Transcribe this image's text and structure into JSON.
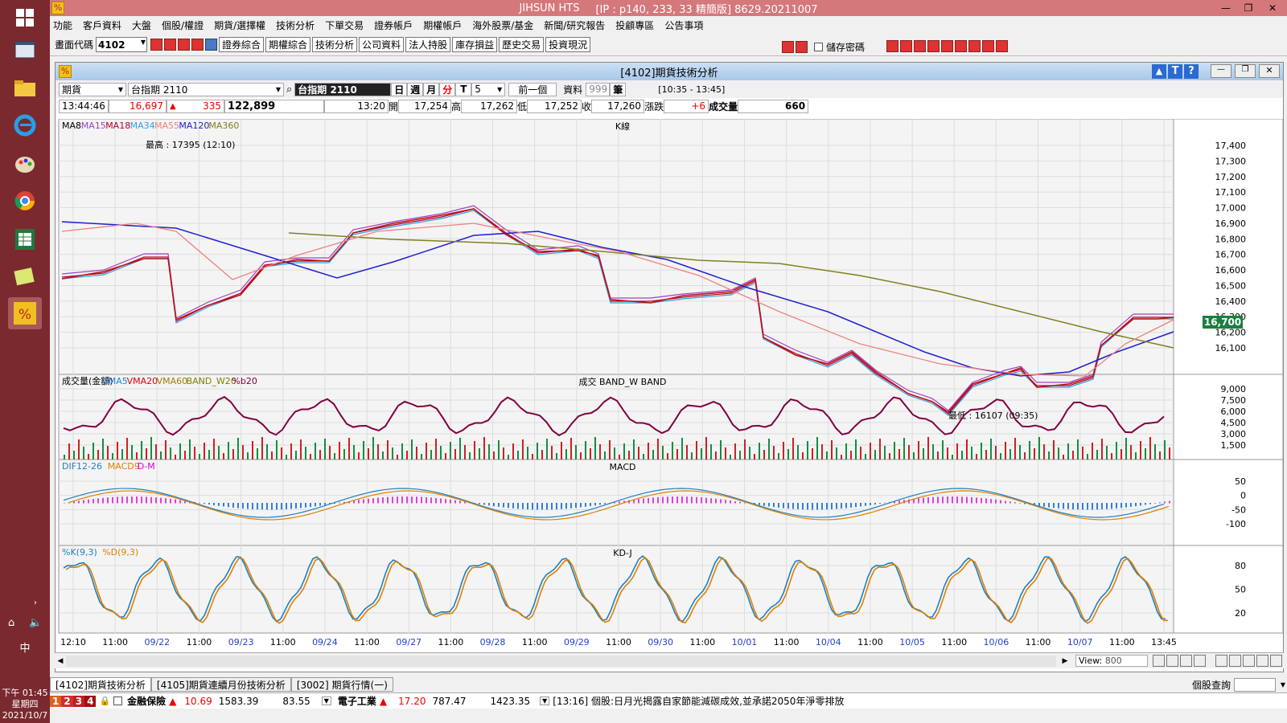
{
  "taskbar": {
    "clock_time": "下午 01:45",
    "clock_day": "星期四",
    "clock_date": "2021/10/7",
    "ime": "中"
  },
  "window": {
    "title": "JIHSUN HTS",
    "title_info": "[IP : p140, 233, 33 精簡版] 8629.20211007"
  },
  "menu": [
    "功能",
    "客戶資料",
    "大盤",
    "個股/權證",
    "期貨/選擇權",
    "技術分析",
    "下單交易",
    "證券帳戶",
    "期權帳戶",
    "海外股票/基金",
    "新聞/研究報告",
    "投顧專區",
    "公告事項"
  ],
  "toolbar": {
    "code_label": "畫面代碼",
    "code_value": "4102",
    "buttons": [
      "證券綜合",
      "期權綜合",
      "技術分析",
      "公司資料",
      "法人持股",
      "庫存損益",
      "歷史交易",
      "投資現況"
    ],
    "save_pwd": "儲存密碼"
  },
  "subwindow": {
    "title": "[4102]期貨技術分析"
  },
  "controls": {
    "type": "期貨",
    "contract": "台指期 2110",
    "name": "台指期 2110",
    "periods": [
      "日",
      "週",
      "月",
      "分",
      "T"
    ],
    "interval": "5",
    "prev": "前一個",
    "data_label": "資料",
    "data_count": "999",
    "unit": "筆",
    "time_range": "[10:35 - 13:45]"
  },
  "quote": {
    "time": "13:44:46",
    "price": "16,697",
    "change": "335",
    "volume_total": "122,899",
    "bar_time": "13:20",
    "open_label": "開",
    "open": "17,254",
    "high_label": "高",
    "high": "17,262",
    "low_label": "低",
    "low": "17,252",
    "close_label": "收",
    "close": "17,260",
    "chg_label": "漲跌",
    "chg": "+6",
    "vol_label": "成交量",
    "vol": "660"
  },
  "panels": {
    "k": {
      "title": "K線",
      "ma_labels": [
        {
          "t": "MA8",
          "c": "#000"
        },
        {
          "t": "MA15",
          "c": "#a040c0"
        },
        {
          "t": "MA18",
          "c": "#b00030"
        },
        {
          "t": "MA34",
          "c": "#30a0e0"
        },
        {
          "t": "MA55",
          "c": "#f08080"
        },
        {
          "t": "MA120",
          "c": "#2020d0"
        },
        {
          "t": "MA360",
          "c": "#808020"
        }
      ],
      "high_note": "最高 : 17395 (12:10)",
      "low_note": "最低 : 16107 (09:35)",
      "yticks": [
        "17,400",
        "17,300",
        "17,200",
        "17,100",
        "17,000",
        "16,900",
        "16,800",
        "16,700",
        "16,600",
        "16,500",
        "16,400",
        "16,300",
        "16,200",
        "16,100"
      ],
      "last": "16,700"
    },
    "vol": {
      "title": "成交  BAND_W  BAND",
      "labels": [
        {
          "t": "成交量(金額)",
          "c": "#000"
        },
        {
          "t": "VMA5",
          "c": "#2080e0"
        },
        {
          "t": "VMA20",
          "c": "#e00000"
        },
        {
          "t": "VMA60",
          "c": "#a08000"
        },
        {
          "t": "BAND_W20",
          "c": "#808000"
        },
        {
          "t": "%b20",
          "c": "#800040"
        }
      ],
      "yticks": [
        "9,000",
        "7,500",
        "6,000",
        "4,500",
        "3,000",
        "1,500"
      ]
    },
    "macd": {
      "title": "MACD",
      "labels": [
        {
          "t": "DIF12-26",
          "c": "#2080c0"
        },
        {
          "t": "MACD9",
          "c": "#e08000"
        },
        {
          "t": "D-M",
          "c": "#e000e0"
        }
      ],
      "yticks": [
        "50",
        "0",
        "-50",
        "-100"
      ]
    },
    "kd": {
      "title": "KD-J",
      "labels": [
        {
          "t": "%K(9,3)",
          "c": "#2080c0"
        },
        {
          "t": "%D(9,3)",
          "c": "#e08000"
        }
      ],
      "yticks": [
        "80",
        "50",
        "20"
      ]
    }
  },
  "xaxis": [
    "12:10",
    "11:00",
    "09/22",
    "11:00",
    "09/23",
    "11:00",
    "09/24",
    "11:00",
    "09/27",
    "11:00",
    "09/28",
    "11:00",
    "09/29",
    "11:00",
    "09/30",
    "11:00",
    "10/01",
    "11:00",
    "10/04",
    "11:00",
    "10/05",
    "11:00",
    "10/06",
    "11:00",
    "10/07",
    "11:00",
    "13:45"
  ],
  "scroll": {
    "view_label": "View:",
    "view_value": "800"
  },
  "tabs": [
    "[4102]期貨技術分析",
    "[4105]期貨連續月份技術分析",
    "[3002] 期貨行情(一)"
  ],
  "stock_query": "個股查詢",
  "ticker": {
    "nums": [
      "1",
      "2",
      "3",
      "4"
    ],
    "item1": "金融保險",
    "v1a": "10.69",
    "v1b": "1583.39",
    "v1c": "83.55",
    "item2": "電子工業",
    "v2a": "17.20",
    "v2b": "787.47",
    "v2c": "1423.35",
    "news": "[13:16]  個股:日月光揭露自家節能減碳成效,並承諾2050年淨零排放"
  }
}
